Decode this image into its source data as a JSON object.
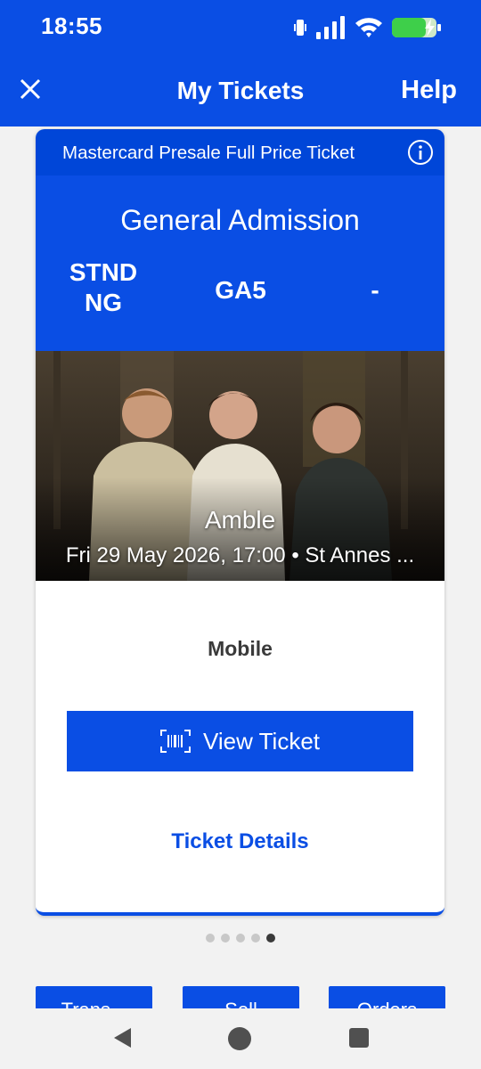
{
  "status_bar": {
    "time": "18:55"
  },
  "app_bar": {
    "title": "My Tickets",
    "help_label": "Help"
  },
  "ticket": {
    "ticket_type": "Mastercard Presale Full Price Ticket",
    "admission": "General Admission",
    "section": "STND\nNG",
    "row": "GA5",
    "seat": "-",
    "event_name": "Amble",
    "event_meta": "Fri 29 May 2026, 17:00 • St Annes ...",
    "delivery_method": "Mobile",
    "view_ticket_label": "View Ticket",
    "ticket_details_label": "Ticket Details"
  },
  "pager": {
    "count": 5,
    "active_index": 4
  },
  "bottom_buttons": [
    "Trans...",
    "Sell",
    "Orders"
  ],
  "colors": {
    "brand_blue": "#0a4ee4",
    "header_blue": "#0046d8",
    "link_blue": "#0a4ee4"
  }
}
